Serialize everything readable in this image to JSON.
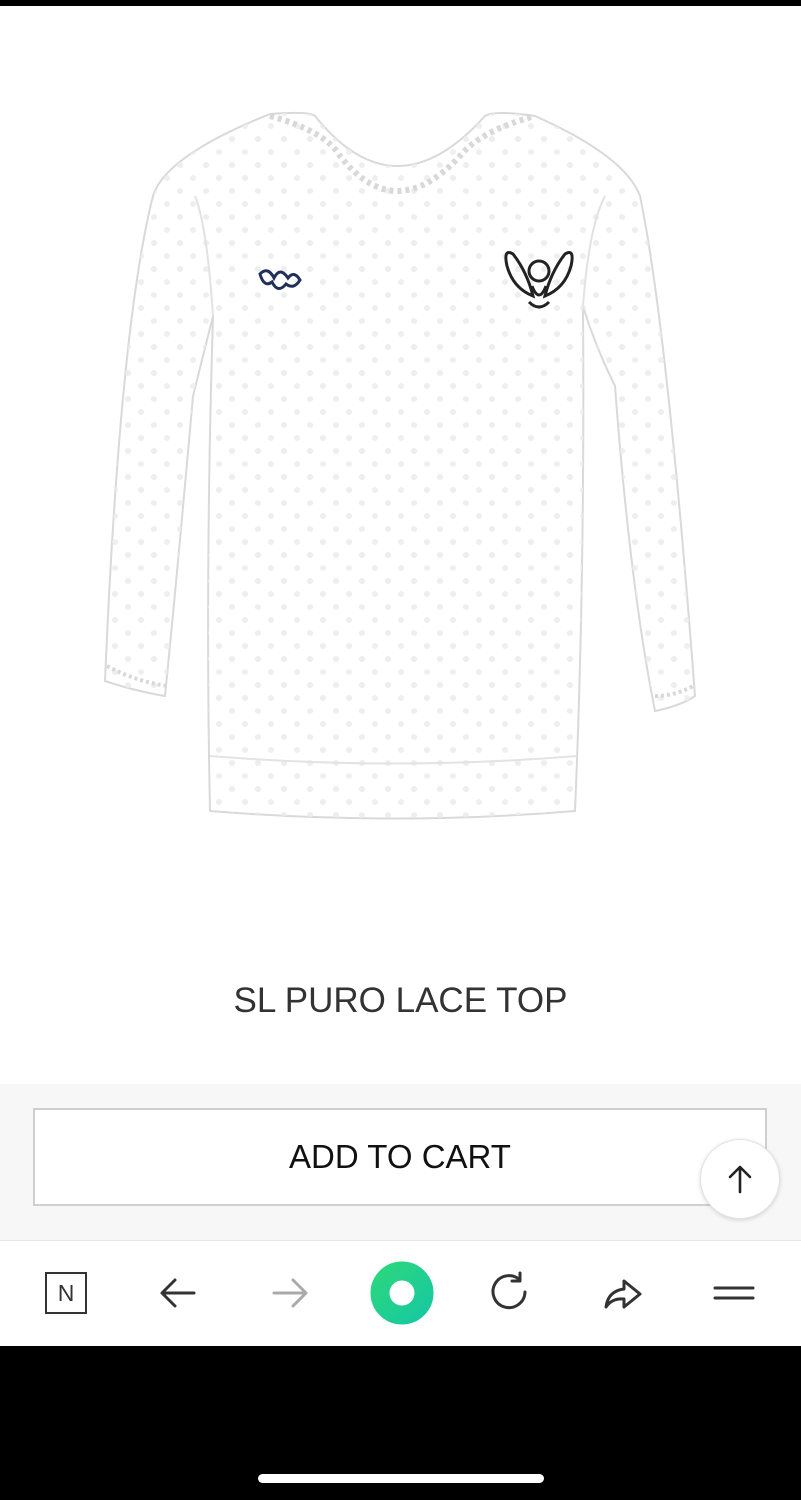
{
  "product": {
    "title": "SL PURO LACE TOP"
  },
  "cart": {
    "button_label": "ADD TO CART"
  },
  "browser_toolbar": {
    "tabs_label": "N",
    "icons": [
      "tabs-icon",
      "back-arrow-icon",
      "forward-arrow-icon",
      "home-ring-icon",
      "reload-icon",
      "share-icon",
      "menu-icon"
    ],
    "accent_color": "#21d47c"
  },
  "colors": {
    "page_background": "#ffffff",
    "strip_background": "#f7f7f7",
    "title_text": "#333333"
  }
}
